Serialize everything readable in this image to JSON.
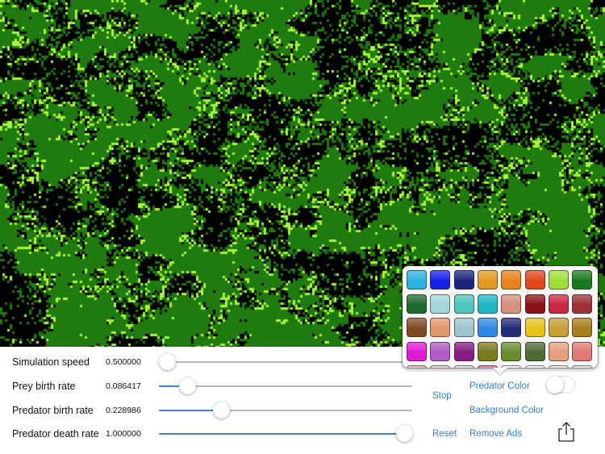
{
  "simulation": {
    "colors": {
      "background": "#000000",
      "prey": "#1f7a0f",
      "prey_dark": "#0f5207",
      "predator": "#a8f53a"
    }
  },
  "controls": [
    {
      "label": "Simulation speed",
      "value_text": "0.500000",
      "fraction": 0.0
    },
    {
      "label": "Prey birth rate",
      "value_text": "0.086417",
      "fraction": 0.086417
    },
    {
      "label": "Predator birth rate",
      "value_text": "0.228986",
      "fraction": 0.228986
    },
    {
      "label": "Predator death rate",
      "value_text": "1.000000",
      "fraction": 1.0
    }
  ],
  "buttons": {
    "stop": "Stop",
    "reset": "Reset",
    "predator_color": "Predator Color",
    "background_color": "Background Color",
    "remove_ads": "Remove Ads"
  },
  "toggle": {
    "on": false
  },
  "icons": {
    "share": "share-icon"
  },
  "accent_color": "#2f7fd6",
  "palette": {
    "rows": [
      [
        "#2bb0e2",
        "#1420e6",
        "#1c237e",
        "#e39a22",
        "#e6831a",
        "#e0471a",
        "#9edd3a",
        "#1a7a22"
      ],
      [
        "#1f6a2e",
        "#a6d6da",
        "#4cc6bd",
        "#1fb8c4",
        "#d5917e",
        "#8a1216",
        "#c92744",
        "#9c3236"
      ],
      [
        "#7d4a24",
        "#e0976a",
        "#9fc4cd",
        "#2f88e2",
        "#232a78",
        "#e6c21a",
        "#c79f36",
        "#a67d1f"
      ],
      [
        "#e21ad6",
        "#b05cc4",
        "#861e82",
        "#7b7a1a",
        "#6a8c2e",
        "#4c6a36",
        "#e59e7e",
        "#e07a74"
      ],
      [
        "#e7b7a8",
        "#f1c6d1",
        "#f1cbd6",
        "#e35fa8",
        "#f2f2f2",
        "#f2f2f2",
        "#e8e8e8",
        "#e3e3e3"
      ]
    ]
  }
}
